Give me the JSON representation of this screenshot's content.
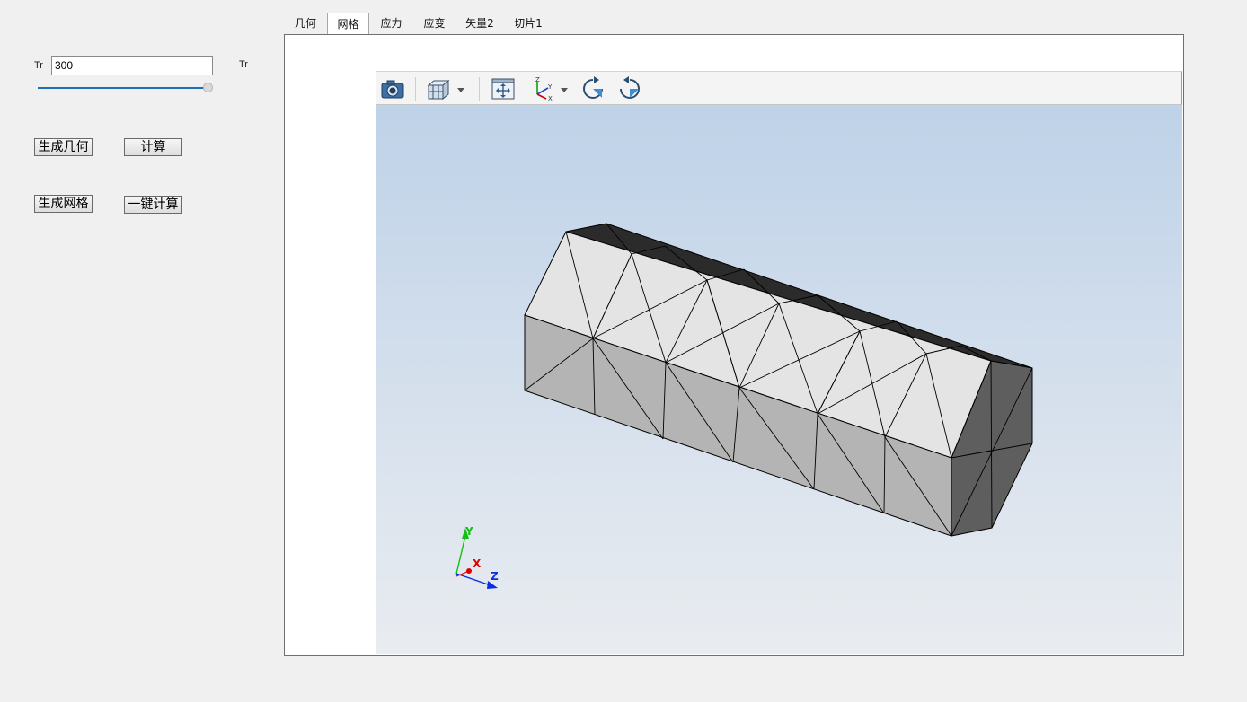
{
  "left_panel": {
    "tr_label_left": "Tr",
    "tr_input_value": "300",
    "tr_label_right": "Tr",
    "slider_value_fraction": 1.0,
    "buttons": {
      "gen_geometry": "生成几何",
      "compute": "计算",
      "gen_mesh": "生成网格",
      "one_click_compute": "一键计算"
    }
  },
  "tabs": [
    {
      "label": "几何",
      "active": false
    },
    {
      "label": "网格",
      "active": true
    },
    {
      "label": "应力",
      "active": false
    },
    {
      "label": "应变",
      "active": false
    },
    {
      "label": "矢量2",
      "active": false
    },
    {
      "label": "切片1",
      "active": false
    }
  ],
  "viewer": {
    "toolbar_icons": [
      "camera-icon",
      "cube-view-icon",
      "dropdown-arrow-icon",
      "fit-all-icon",
      "axes-orientation-icon",
      "dropdown-arrow-icon",
      "rotate-clockwise-icon",
      "rotate-counterclockwise-icon"
    ],
    "axis_triad": {
      "x_label": "X",
      "y_label": "Y",
      "z_label": "Z"
    },
    "colors": {
      "top_face": "#2b2b2b",
      "front_upper_face": "#e4e4e4",
      "front_lower_face": "#b4b4b4",
      "end_face": "#5e5e5e",
      "x_axis": "#e00000",
      "y_axis": "#12c012",
      "z_axis": "#0a2ee0"
    }
  }
}
